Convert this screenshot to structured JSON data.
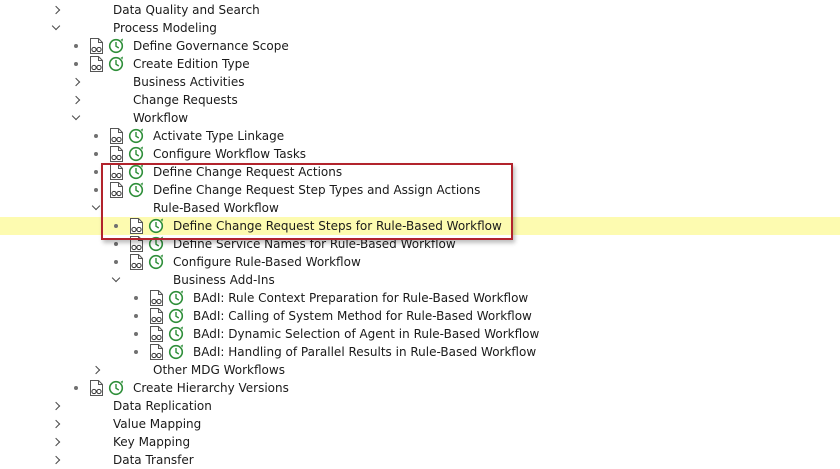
{
  "tree": {
    "items": [
      {
        "label": "Data Quality and Search"
      },
      {
        "label": "Process Modeling"
      },
      {
        "label": "Define Governance Scope"
      },
      {
        "label": "Create Edition Type"
      },
      {
        "label": "Business Activities"
      },
      {
        "label": "Change Requests"
      },
      {
        "label": "Workflow"
      },
      {
        "label": "Activate Type Linkage"
      },
      {
        "label": "Configure Workflow Tasks"
      },
      {
        "label": "Define Change Request Actions"
      },
      {
        "label": "Define Change Request Step Types and Assign Actions"
      },
      {
        "label": "Rule-Based Workflow"
      },
      {
        "label": "Define Change Request Steps for Rule-Based Workflow"
      },
      {
        "label": "Define Service Names for Rule-Based Workflow"
      },
      {
        "label": "Configure Rule-Based Workflow"
      },
      {
        "label": "Business Add-Ins"
      },
      {
        "label": "BAdI: Rule Context Preparation for Rule-Based Workflow"
      },
      {
        "label": "BAdI: Calling of System Method for Rule-Based Workflow"
      },
      {
        "label": "BAdI: Dynamic Selection of Agent in Rule-Based Workflow"
      },
      {
        "label": "BAdI: Handling of Parallel Results in Rule-Based Workflow"
      },
      {
        "label": "Other MDG Workflows"
      },
      {
        "label": "Create Hierarchy Versions"
      },
      {
        "label": "Data Replication"
      },
      {
        "label": "Value Mapping"
      },
      {
        "label": "Key Mapping"
      },
      {
        "label": "Data Transfer"
      }
    ]
  },
  "colors": {
    "selected_row": "#fdfbb0",
    "highlight_border": "#b2232c",
    "exec_icon_green": "#2f8f3a"
  },
  "icons": {
    "expand": "chevron-right-icon",
    "collapse": "chevron-down-icon",
    "documentation": "documentation-icon",
    "execute": "execute-clock-icon"
  }
}
